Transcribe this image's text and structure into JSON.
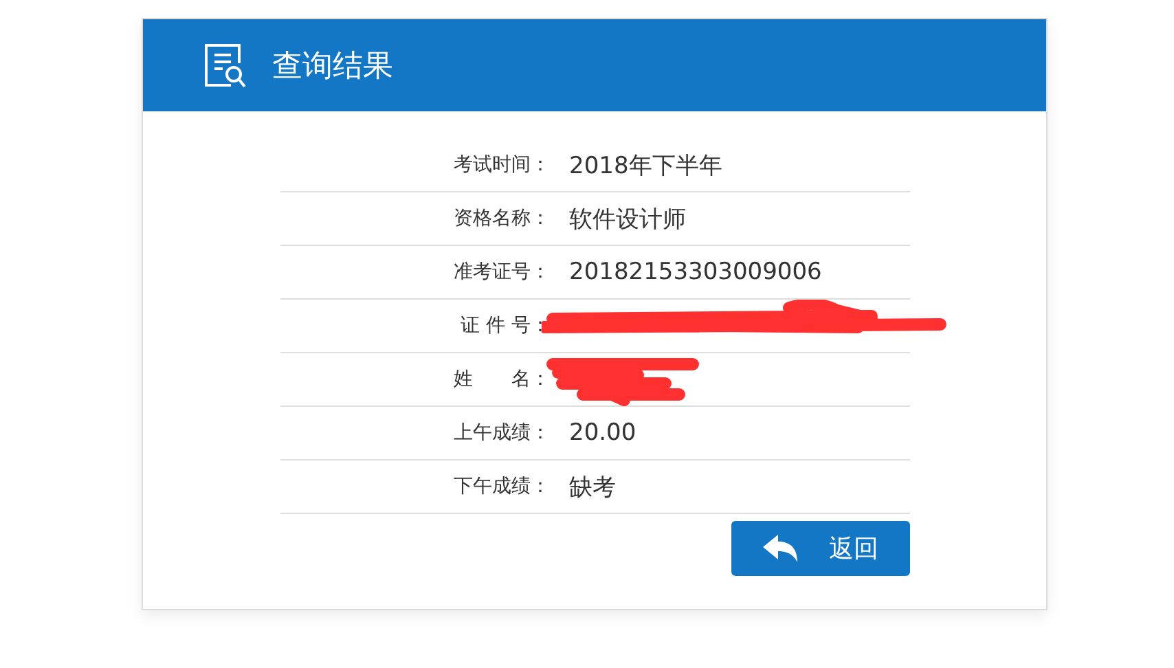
{
  "header": {
    "title": "查询结果"
  },
  "rows": [
    {
      "kind": "text",
      "label": "考试时间：",
      "value": "2018年下半年"
    },
    {
      "kind": "text",
      "label": "资格名称：",
      "value": "软件设计师"
    },
    {
      "kind": "text",
      "label": "准考证号：",
      "value": "20182153303009006"
    },
    {
      "kind": "redacted",
      "label": "证 件 号："
    },
    {
      "kind": "redacted",
      "label": "姓　　名："
    },
    {
      "kind": "text",
      "label": "上午成绩：",
      "value": "20.00"
    },
    {
      "kind": "text",
      "label": "下午成绩：",
      "value": "缺考"
    }
  ],
  "back_button": {
    "label": "返回"
  }
}
